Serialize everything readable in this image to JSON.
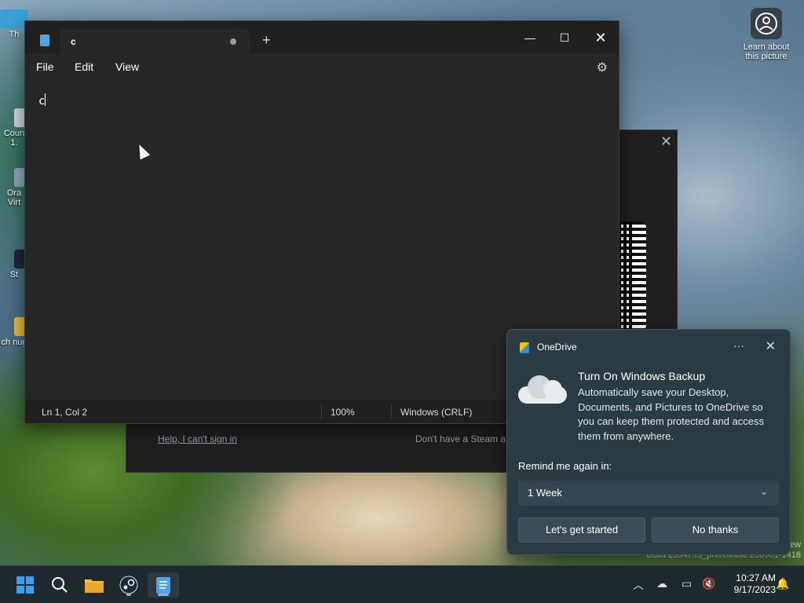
{
  "desktop": {
    "icons": [
      {
        "label": "Th"
      },
      {
        "label": "Coun 1."
      },
      {
        "label": "Ora Virt"
      },
      {
        "label": "St"
      },
      {
        "label": "ch nug"
      }
    ],
    "learn_label": "Learn about this picture"
  },
  "steam": {
    "help_link": "Help, I can't sign in",
    "signup_text": "Don't have a Steam a"
  },
  "notepad": {
    "tab_title": "c",
    "menu": [
      "File",
      "Edit",
      "View"
    ],
    "content": "c",
    "status": {
      "position": "Ln 1, Col 2",
      "zoom": "100%",
      "line_ending": "Windows (CRLF)"
    }
  },
  "toast": {
    "app_name": "OneDrive",
    "heading": "Turn On Windows Backup",
    "body": "Automatically save your Desktop, Documents, and Pictures to OneDrive so you can keep them protected and access them from anywhere.",
    "remind_label": "Remind me again in:",
    "remind_value": "1 Week",
    "primary_button": "Let's get started",
    "secondary_button": "No thanks"
  },
  "watermark": {
    "line1": "ew",
    "line2": "Build 25947.rs_prerelease.230901-1416"
  },
  "taskbar": {
    "time": "10:27 AM",
    "date": "9/17/2023"
  },
  "colors": {
    "accent": "#4fa3e8",
    "toast_bg": "#2b3b44",
    "notepad_bg": "#272727"
  }
}
